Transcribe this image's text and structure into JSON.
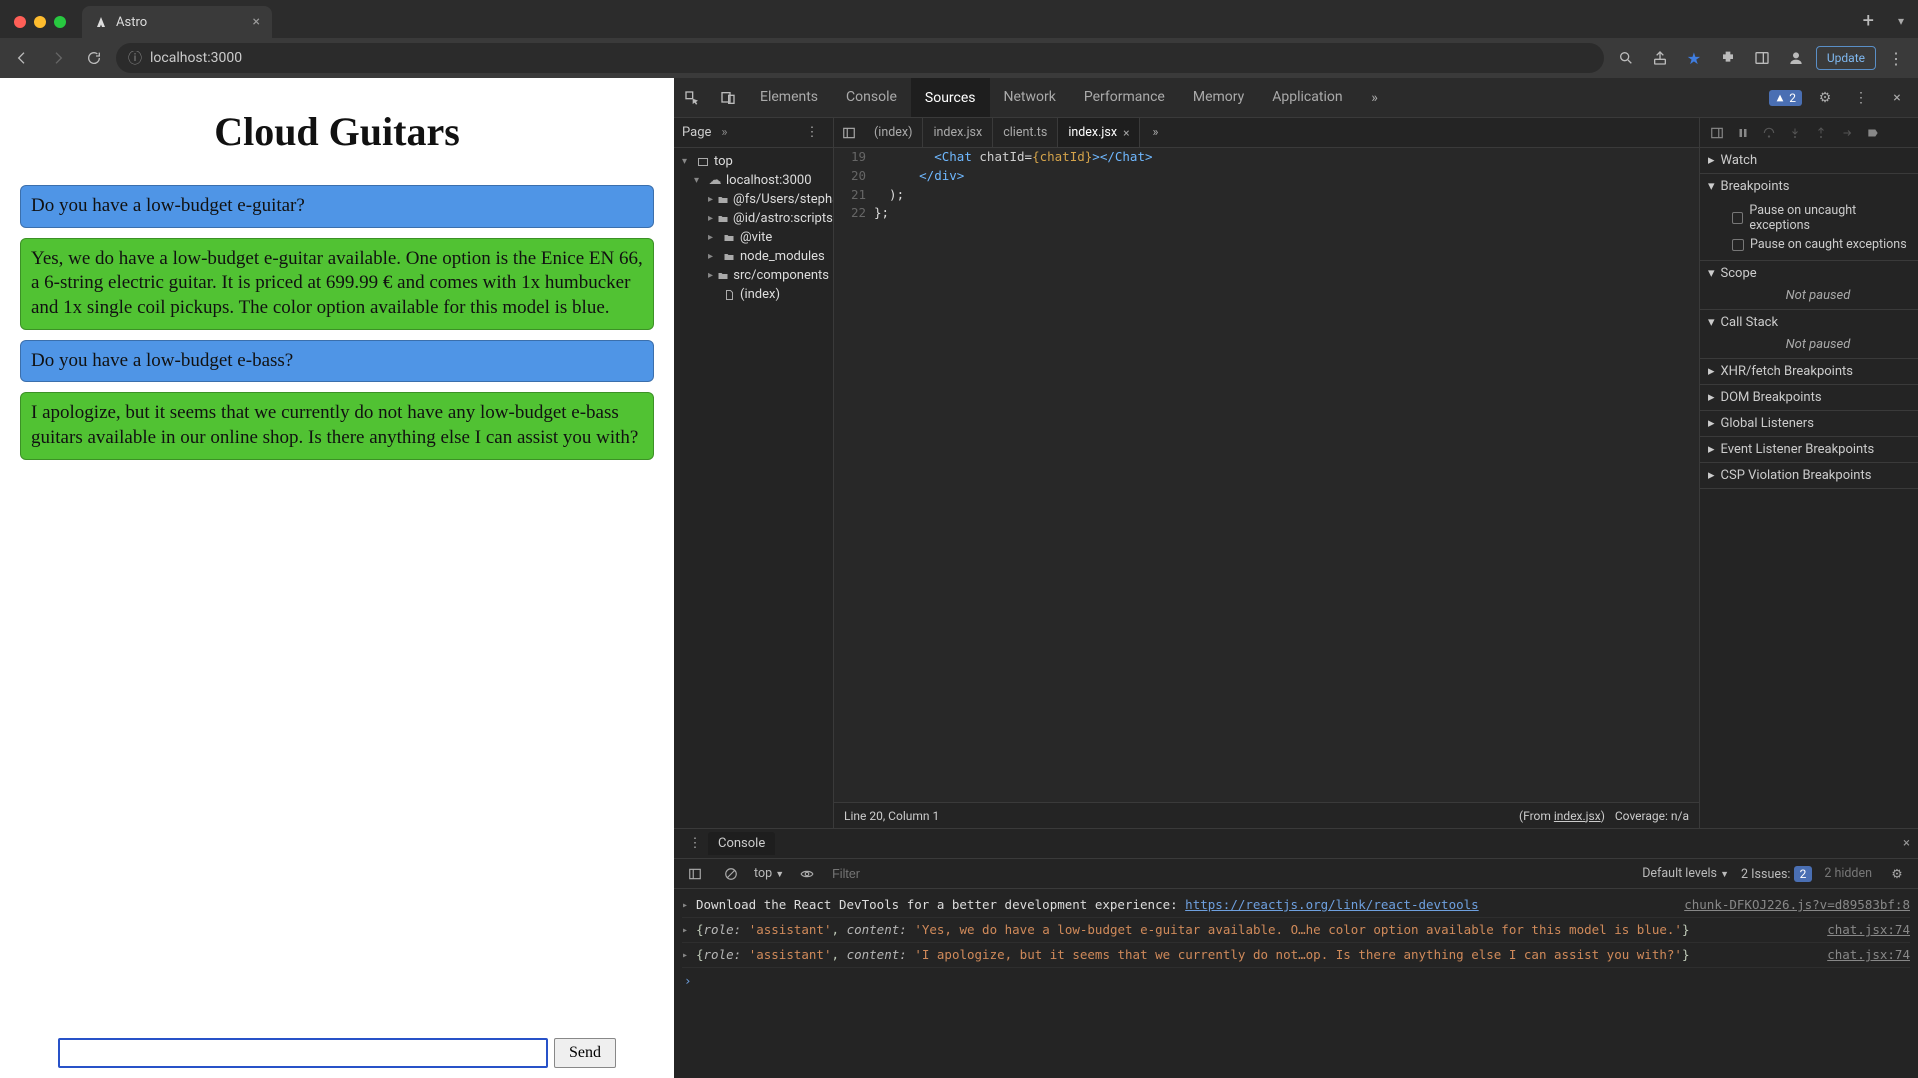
{
  "browser": {
    "tab_title": "Astro",
    "url": "localhost:3000",
    "update_label": "Update"
  },
  "page": {
    "title": "Cloud Guitars",
    "messages": [
      {
        "role": "user",
        "text": "Do you have a low-budget e-guitar?"
      },
      {
        "role": "assistant",
        "text": "Yes, we do have a low-budget e-guitar available. One option is the Enice EN 66, a 6-string electric guitar. It is priced at 699.99 € and comes with 1x humbucker and 1x single coil pickups. The color option available for this model is blue."
      },
      {
        "role": "user",
        "text": "Do you have a low-budget e-bass?"
      },
      {
        "role": "assistant",
        "text": "I apologize, but it seems that we currently do not have any low-budget e-bass guitars available in our online shop. Is there anything else I can assist you with?"
      }
    ],
    "send_label": "Send"
  },
  "devtools": {
    "tabs": [
      "Elements",
      "Console",
      "Sources",
      "Network",
      "Performance",
      "Memory",
      "Application"
    ],
    "active_tab": "Sources",
    "issues_badge": "2",
    "filetree": {
      "head_tab": "Page",
      "root": "top",
      "host": "localhost:3000",
      "folders": [
        "@fs/Users/stepha",
        "@id/astro:scripts",
        "@vite",
        "node_modules",
        "src/components"
      ],
      "file": "(index)"
    },
    "editor": {
      "tabs": [
        "(index)",
        "index.jsx",
        "client.ts",
        "index.jsx"
      ],
      "active_tab_index": 3,
      "lines": [
        {
          "n": "19",
          "html": "        <span class='tok-tag'>&lt;Chat</span> <span class='tok-attr'>chatId</span>=<span class='tok-brace'>{chatId}</span><span class='tok-tag'>&gt;&lt;/Chat&gt;</span>"
        },
        {
          "n": "20",
          "html": "      <span class='tok-tag'>&lt;/div&gt;</span>"
        },
        {
          "n": "21",
          "html": "  );"
        },
        {
          "n": "22",
          "html": "};"
        }
      ],
      "cursor_status": "Line 20, Column 1",
      "from_label": "(From ",
      "from_link": "index.jsx",
      "from_suffix": ")",
      "coverage": "Coverage: n/a"
    },
    "debugger": {
      "sections": {
        "watch": "Watch",
        "breakpoints": "Breakpoints",
        "bp_items": [
          "Pause on uncaught exceptions",
          "Pause on caught exceptions"
        ],
        "scope": "Scope",
        "scope_msg": "Not paused",
        "callstack": "Call Stack",
        "cs_msg": "Not paused",
        "xhr": "XHR/fetch Breakpoints",
        "dom": "DOM Breakpoints",
        "global": "Global Listeners",
        "event": "Event Listener Breakpoints",
        "csp": "CSP Violation Breakpoints"
      }
    },
    "console": {
      "tab_label": "Console",
      "context": "top",
      "filter_placeholder": "Filter",
      "levels": "Default levels",
      "issues_label": "2 Issues:",
      "issues_count": "2",
      "hidden": "2 hidden",
      "logs": [
        {
          "kind": "plain",
          "src": "chunk-DFKOJ226.js?v=d89583bf:8",
          "text": "Download the React DevTools for a better development experience: ",
          "link": "https://reactjs.org/link/react-devtools"
        },
        {
          "kind": "obj",
          "src": "chat.jsx:74",
          "text": "{role: 'assistant', content: 'Yes, we do have a low-budget e-guitar available. O…he color option available for this model is blue.'}"
        },
        {
          "kind": "obj",
          "src": "chat.jsx:74",
          "text": "{role: 'assistant', content: 'I apologize, but it seems that we currently do not…op. Is there anything else I can assist you with?'}"
        }
      ]
    }
  }
}
